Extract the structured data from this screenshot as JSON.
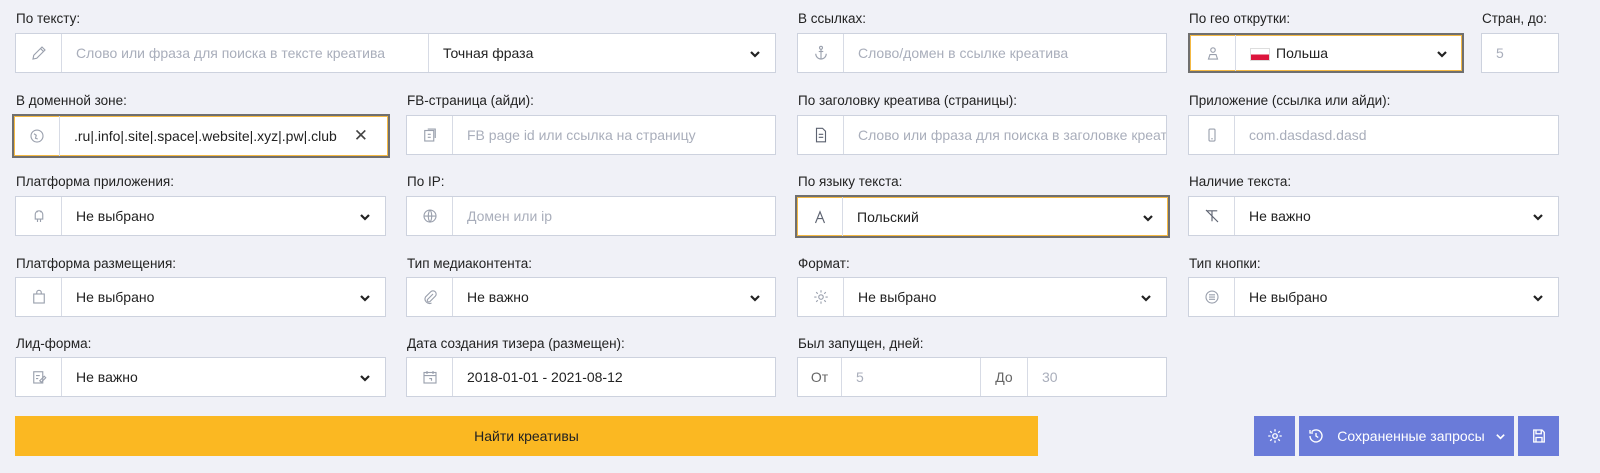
{
  "text_search": {
    "label": "По тексту:",
    "placeholder": "Слово или фраза для поиска в тексте креатива",
    "match_mode": "Точная фраза",
    "icon": "pencil-icon"
  },
  "links": {
    "label": "В ссылках:",
    "placeholder": "Слово/домен в ссылке креатива",
    "icon": "anchor-icon"
  },
  "geo": {
    "label": "По гео открутки:",
    "value": "Польша",
    "icon": "map-user-icon"
  },
  "countries": {
    "label": "Стран, до:",
    "placeholder": "5"
  },
  "domain_zone": {
    "label": "В доменной зоне:",
    "value": ".ru|.info|.site|.space|.website|.xyz|.pw|.club",
    "clear": "✕",
    "icon": "globe-icon"
  },
  "fb_page": {
    "label": "FB-страница (айди):",
    "placeholder": "FB page id или ссылка на страницу",
    "icon": "fb-page-icon"
  },
  "headline": {
    "label": "По заголовку креатива (страницы):",
    "placeholder": "Слово или фраза для поиска в заголовке креатива",
    "icon": "document-icon"
  },
  "app": {
    "label": "Приложение (ссылка или айди):",
    "placeholder": "com.dasdasd.dasd",
    "icon": "phone-icon"
  },
  "app_platform": {
    "label": "Платформа приложения:",
    "value": "Не выбрано",
    "icon": "android-icon"
  },
  "ip": {
    "label": "По IP:",
    "placeholder": "Домен или  ip",
    "icon": "globe-ip-icon"
  },
  "language": {
    "label": "По языку текста:",
    "value": "Польский",
    "icon": "font-icon"
  },
  "has_text": {
    "label": "Наличие текста:",
    "value": "Не важно",
    "icon": "text-strike-icon"
  },
  "placement": {
    "label": "Платформа размещения:",
    "value": "Не выбрано",
    "icon": "bag-icon"
  },
  "media_type": {
    "label": "Тип медиаконтента:",
    "value": "Не важно",
    "icon": "paperclip-icon"
  },
  "format": {
    "label": "Формат:",
    "value": "Не выбрано",
    "icon": "gear-icon"
  },
  "button_type": {
    "label": "Тип кнопки:",
    "value": "Не выбрано",
    "icon": "list-circle-icon"
  },
  "lead_form": {
    "label": "Лид-форма:",
    "value": "Не важно",
    "icon": "edit-form-icon"
  },
  "created_date": {
    "label": "Дата создания тизера (размещен):",
    "value": "2018-01-01 - 2021-08-12",
    "icon": "calendar-icon"
  },
  "running_days": {
    "label": "Был запущен, дней:",
    "from_label": "От",
    "from_placeholder": "5",
    "to_label": "До",
    "to_placeholder": "30"
  },
  "actions": {
    "find": "Найти креативы",
    "saved_queries": "Сохраненные запросы"
  },
  "colors": {
    "accent_yellow": "#fbb822",
    "accent_blue": "#6a7bd9",
    "background": "#f0f1f7"
  }
}
